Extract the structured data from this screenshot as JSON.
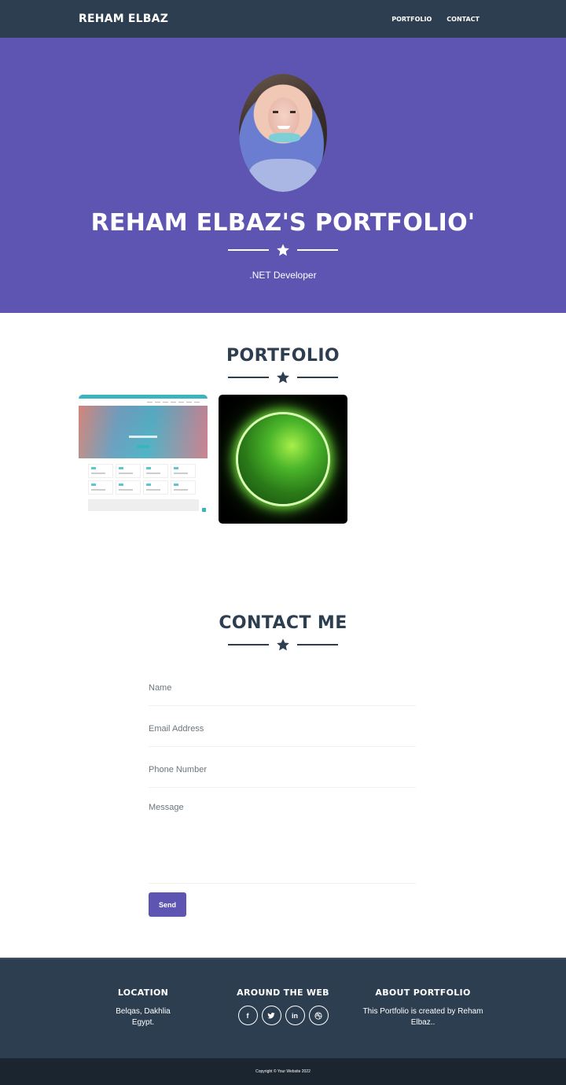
{
  "navbar": {
    "brand": "REHAM ELBAZ",
    "links": [
      {
        "label": "PORTFOLIO"
      },
      {
        "label": "CONTACT"
      }
    ]
  },
  "hero": {
    "avatar_alt": "Profile photo of Reham Elbaz",
    "title": "REHAM ELBAZ'S PORTFOLIO'",
    "divider_icon": "star-icon",
    "subtitle": ".NET Developer"
  },
  "portfolio": {
    "title": "PORTFOLIO",
    "divider_icon": "star-icon",
    "items": [
      {
        "name": "website-project-thumbnail",
        "description": "Screenshot of a website with teal header and banner"
      },
      {
        "name": "green-globe-thumbnail",
        "description": "Glowing green earth globe on black background"
      }
    ]
  },
  "contact": {
    "title": "CONTACT ME",
    "divider_icon": "star-icon",
    "fields": {
      "name": {
        "placeholder": "Name",
        "value": ""
      },
      "email": {
        "placeholder": "Email Address",
        "value": ""
      },
      "phone": {
        "placeholder": "Phone Number",
        "value": ""
      },
      "message": {
        "placeholder": "Message",
        "value": ""
      }
    },
    "send_label": "Send"
  },
  "footer": {
    "location": {
      "title": "LOCATION",
      "line1": "Belqas, Dakhlia",
      "line2": "Egypt."
    },
    "web": {
      "title": "AROUND THE WEB",
      "socials": [
        {
          "icon": "facebook-icon",
          "glyph": "f"
        },
        {
          "icon": "twitter-icon"
        },
        {
          "icon": "linkedin-icon",
          "glyph": "in"
        },
        {
          "icon": "dribbble-icon"
        }
      ]
    },
    "about": {
      "title": "ABOUT PORTFOLIO",
      "text": "This Portfolio is created by Reham Elbaz.."
    },
    "copyright": "Copyright © Your Website 2022"
  },
  "colors": {
    "primary_dark": "#2c3e50",
    "accent_purple": "#5e55b3",
    "copyright_bg": "#1a252f"
  }
}
